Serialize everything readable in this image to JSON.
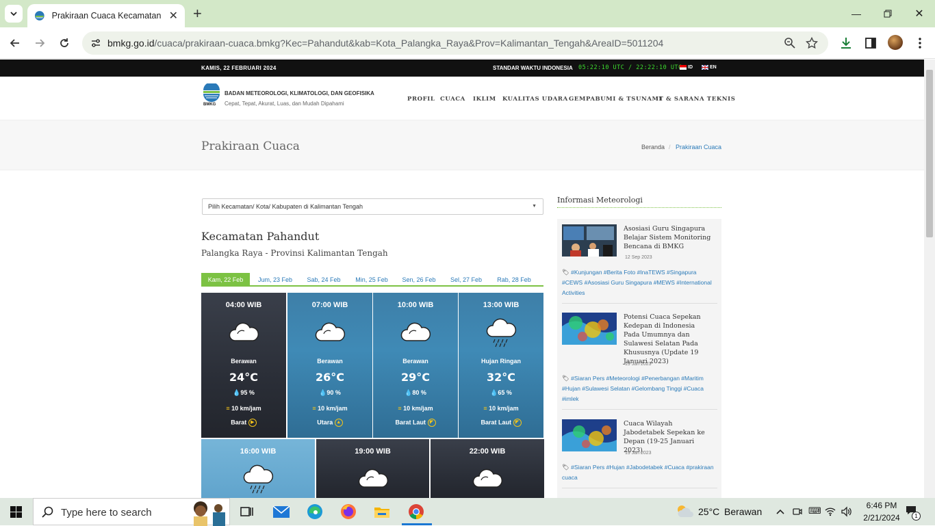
{
  "browser": {
    "tab_title": "Prakiraan Cuaca Kecamatan Pahandut",
    "url_domain": "bmkg.go.id",
    "url_path": "/cuaca/prakiraan-cuaca.bmkg?Kec=Pahandut&kab=Kota_Palangka_Raya&Prov=Kalimantan_Tengah&AreaID=5011204"
  },
  "topbar": {
    "date": "KAMIS, 22 FEBRUARI 2024",
    "time_label": "STANDAR WAKTU INDONESIA",
    "clock": "05:22:10 UTC / 22:22:10 UTC",
    "lang_id": "ID",
    "lang_en": "EN"
  },
  "header": {
    "logo_text": "BMKG",
    "org_name": "BADAN METEOROLOGI, KLIMATOLOGI, DAN GEOFISIKA",
    "tagline": "Cepat, Tepat, Akurat, Luas, dan Mudah Dipahami",
    "nav": [
      "PROFIL",
      "CUACA",
      "IKLIM",
      "KUALITAS UDARA",
      "GEMPABUMI & TSUNAMI",
      "IT & SARANA TEKNIS"
    ]
  },
  "titlebar": {
    "title": "Prakiraan Cuaca",
    "breadcrumb_home": "Beranda",
    "breadcrumb_sep": "/",
    "breadcrumb_current": "Prakiraan Cuaca"
  },
  "selector": {
    "placeholder": "Pilih Kecamatan/ Kota/ Kabupaten di Kalimantan Tengah"
  },
  "location": {
    "name": "Kecamatan Pahandut",
    "region": "Palangka Raya - Provinsi Kalimantan Tengah"
  },
  "day_tabs": [
    "Kam, 22 Feb",
    "Jum, 23 Feb",
    "Sab, 24 Feb",
    "Min, 25 Feb",
    "Sen, 26 Feb",
    "Sel, 27 Feb",
    "Rab, 28 Feb"
  ],
  "forecast": [
    {
      "time": "04:00 WIB",
      "desc": "Berawan",
      "temp": "24°C",
      "humidity": "95 %",
      "wind": "10 km/jam",
      "dir": "Barat",
      "icon": "cloud-icon"
    },
    {
      "time": "07:00 WIB",
      "desc": "Berawan",
      "temp": "26°C",
      "humidity": "90 %",
      "wind": "10 km/jam",
      "dir": "Utara",
      "icon": "cloud-icon"
    },
    {
      "time": "10:00 WIB",
      "desc": "Berawan",
      "temp": "29°C",
      "humidity": "80 %",
      "wind": "10 km/jam",
      "dir": "Barat Laut",
      "icon": "cloud-icon"
    },
    {
      "time": "13:00 WIB",
      "desc": "Hujan Ringan",
      "temp": "32°C",
      "humidity": "65 %",
      "wind": "10 km/jam",
      "dir": "Barat Laut",
      "icon": "rain-cloud-icon"
    },
    {
      "time": "16:00 WIB",
      "icon": "rain-cloud-icon"
    },
    {
      "time": "19:00 WIB",
      "icon": "cloud-icon"
    },
    {
      "time": "22:00 WIB",
      "icon": "cloud-icon"
    }
  ],
  "sidebar": {
    "heading": "Informasi Meteorologi",
    "news": [
      {
        "title": "Asosiasi Guru Singapura Belajar Sistem Monitoring Bencana di BMKG",
        "date": "12 Sep 2023",
        "tags": "#Kunjungan #Berita Foto #InaTEWS #Singapura #CEWS #Asosiasi Guru Singapura #MEWS #International Activities"
      },
      {
        "title": "Potensi Cuaca Sepekan Kedepan di Indonesia Pada Umumnya dan Sulawesi Selatan Pada Khususnya (Update 19 Januari 2023)",
        "date": "19 Jan 2023",
        "tags": "#Siaran Pers #Meteorologi #Penerbangan #Maritim #Hujan #Sulawesi Selatan #Gelombang Tinggi #Cuaca #imlek"
      },
      {
        "title": "Cuaca Wilayah Jabodetabek Sepekan ke Depan (19-25 Januari 2023)",
        "date": "19 Jan 2023",
        "tags": "#Siaran Pers #Hujan #Jabodetabek #Cuaca #prakiraan cuaca"
      }
    ]
  },
  "taskbar": {
    "search_placeholder": "Type here to search",
    "weather_temp": "25°C",
    "weather_desc": "Berawan",
    "time": "6:46 PM",
    "date": "2/21/2024",
    "notification_count": "1"
  },
  "colors": {
    "accent_green": "#7cc243",
    "link_blue": "#2a7ab8",
    "clock_green": "#3ddc2f",
    "tab_strip": "#d3e8c8"
  }
}
